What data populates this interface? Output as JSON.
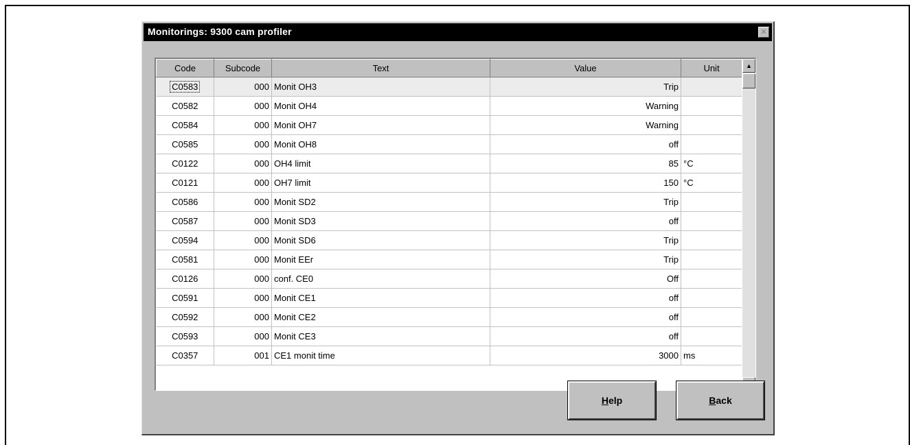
{
  "window": {
    "title": "Monitorings: 9300 cam profiler",
    "close_label": "✕"
  },
  "table": {
    "headers": [
      "Code",
      "Subcode",
      "Text",
      "Value",
      "Unit"
    ],
    "rows": [
      {
        "code": "C0583",
        "subcode": "000",
        "text": "Monit OH3",
        "value": "Trip",
        "unit": ""
      },
      {
        "code": "C0582",
        "subcode": "000",
        "text": "Monit OH4",
        "value": "Warning",
        "unit": ""
      },
      {
        "code": "C0584",
        "subcode": "000",
        "text": "Monit OH7",
        "value": "Warning",
        "unit": ""
      },
      {
        "code": "C0585",
        "subcode": "000",
        "text": "Monit OH8",
        "value": "off",
        "unit": ""
      },
      {
        "code": "C0122",
        "subcode": "000",
        "text": "OH4 limit",
        "value": "85",
        "unit": "°C"
      },
      {
        "code": "C0121",
        "subcode": "000",
        "text": "OH7 limit",
        "value": "150",
        "unit": "°C"
      },
      {
        "code": "C0586",
        "subcode": "000",
        "text": "Monit SD2",
        "value": "Trip",
        "unit": ""
      },
      {
        "code": "C0587",
        "subcode": "000",
        "text": "Monit SD3",
        "value": "off",
        "unit": ""
      },
      {
        "code": "C0594",
        "subcode": "000",
        "text": "Monit SD6",
        "value": "Trip",
        "unit": ""
      },
      {
        "code": "C0581",
        "subcode": "000",
        "text": "Monit EEr",
        "value": "Trip",
        "unit": ""
      },
      {
        "code": "C0126",
        "subcode": "000",
        "text": "conf. CE0",
        "value": "Off",
        "unit": ""
      },
      {
        "code": "C0591",
        "subcode": "000",
        "text": "Monit CE1",
        "value": "off",
        "unit": ""
      },
      {
        "code": "C0592",
        "subcode": "000",
        "text": "Monit CE2",
        "value": "off",
        "unit": ""
      },
      {
        "code": "C0593",
        "subcode": "000",
        "text": "Monit CE3",
        "value": "off",
        "unit": ""
      },
      {
        "code": "C0357",
        "subcode": "001",
        "text": "CE1 monit time",
        "value": "3000",
        "unit": "ms"
      }
    ],
    "selected_row": 0
  },
  "buttons": {
    "help": {
      "accel": "H",
      "rest": "elp"
    },
    "back": {
      "accel": "B",
      "rest": "ack"
    }
  },
  "icons": {
    "scroll_up": "triangle-up",
    "scroll_down": "triangle-down",
    "close": "x"
  }
}
